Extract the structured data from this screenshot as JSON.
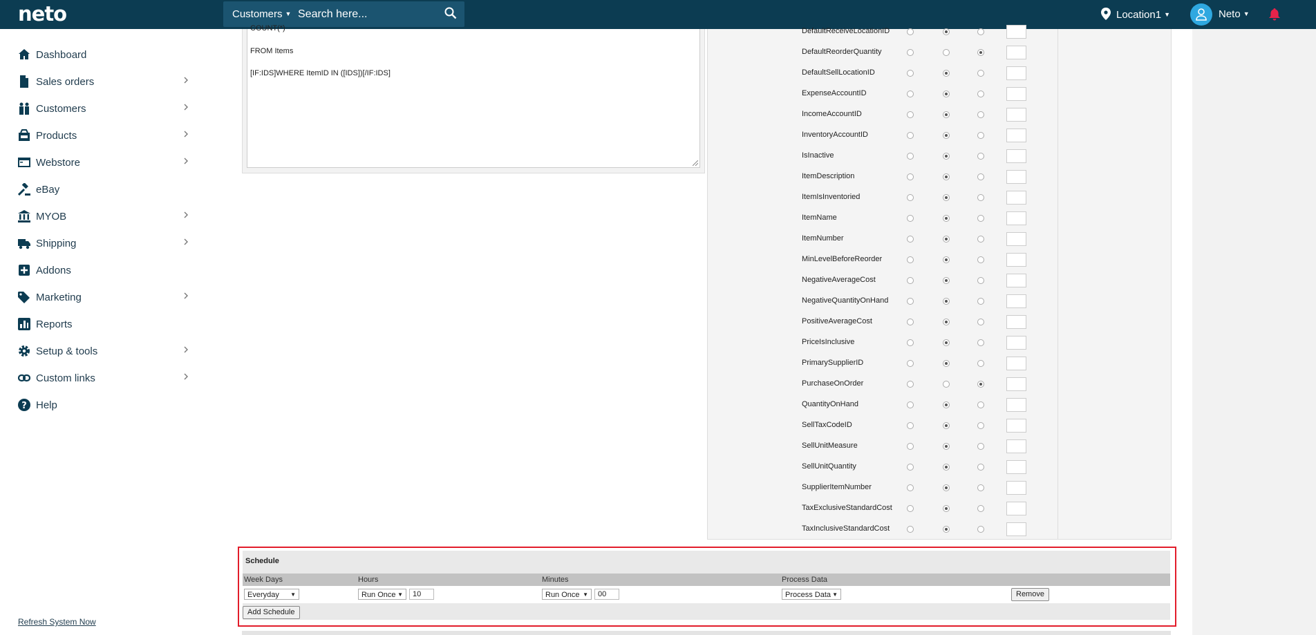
{
  "topbar": {
    "logo": "neto",
    "search_scope": "Customers",
    "search_placeholder": "Search here...",
    "location": "Location1",
    "user": "Neto"
  },
  "sidebar": {
    "items": [
      {
        "label": "Dashboard",
        "icon": "home-icon",
        "has_chevron": false
      },
      {
        "label": "Sales orders",
        "icon": "document-icon",
        "has_chevron": true
      },
      {
        "label": "Customers",
        "icon": "people-icon",
        "has_chevron": true
      },
      {
        "label": "Products",
        "icon": "products-icon",
        "has_chevron": true
      },
      {
        "label": "Webstore",
        "icon": "webstore-icon",
        "has_chevron": true
      },
      {
        "label": "eBay",
        "icon": "gavel-icon",
        "has_chevron": false
      },
      {
        "label": "MYOB",
        "icon": "bank-icon",
        "has_chevron": true
      },
      {
        "label": "Shipping",
        "icon": "truck-icon",
        "has_chevron": true
      },
      {
        "label": "Addons",
        "icon": "plus-square-icon",
        "has_chevron": false
      },
      {
        "label": "Marketing",
        "icon": "tag-icon",
        "has_chevron": true
      },
      {
        "label": "Reports",
        "icon": "chart-icon",
        "has_chevron": false
      },
      {
        "label": "Setup & tools",
        "icon": "gear-icon",
        "has_chevron": true
      },
      {
        "label": "Custom links",
        "icon": "link-icon",
        "has_chevron": true
      },
      {
        "label": "Help",
        "icon": "help-icon",
        "has_chevron": false
      }
    ],
    "refresh_link": "Refresh System Now"
  },
  "sql": {
    "lines": [
      "COUNT(*)",
      "FROM Items",
      "[IF:IDS]WHERE ItemID IN ([IDS])[/IF:IDS]"
    ]
  },
  "fields": {
    "rows": [
      {
        "name": "DefaultReceiveLocationID",
        "selected": 1
      },
      {
        "name": "DefaultReorderQuantity",
        "selected": 2
      },
      {
        "name": "DefaultSellLocationID",
        "selected": 1
      },
      {
        "name": "ExpenseAccountID",
        "selected": 1
      },
      {
        "name": "IncomeAccountID",
        "selected": 1
      },
      {
        "name": "InventoryAccountID",
        "selected": 1
      },
      {
        "name": "IsInactive",
        "selected": 1
      },
      {
        "name": "ItemDescription",
        "selected": 1
      },
      {
        "name": "ItemIsInventoried",
        "selected": 1
      },
      {
        "name": "ItemName",
        "selected": 1
      },
      {
        "name": "ItemNumber",
        "selected": 1
      },
      {
        "name": "MinLevelBeforeReorder",
        "selected": 1
      },
      {
        "name": "NegativeAverageCost",
        "selected": 1
      },
      {
        "name": "NegativeQuantityOnHand",
        "selected": 1
      },
      {
        "name": "PositiveAverageCost",
        "selected": 1
      },
      {
        "name": "PriceIsInclusive",
        "selected": 1
      },
      {
        "name": "PrimarySupplierID",
        "selected": 1
      },
      {
        "name": "PurchaseOnOrder",
        "selected": 2
      },
      {
        "name": "QuantityOnHand",
        "selected": 1
      },
      {
        "name": "SellTaxCodeID",
        "selected": 1
      },
      {
        "name": "SellUnitMeasure",
        "selected": 1
      },
      {
        "name": "SellUnitQuantity",
        "selected": 1
      },
      {
        "name": "SupplierItemNumber",
        "selected": 1
      },
      {
        "name": "TaxExclusiveStandardCost",
        "selected": 1
      },
      {
        "name": "TaxInclusiveStandardCost",
        "selected": 1
      }
    ]
  },
  "schedule": {
    "title": "Schedule",
    "headers": {
      "week_days": "Week Days",
      "hours": "Hours",
      "minutes": "Minutes",
      "process_data": "Process Data"
    },
    "row": {
      "week_days": "Everyday",
      "hours_mode": "Run Once",
      "hours_value": "10",
      "minutes_mode": "Run Once",
      "minutes_value": "00",
      "process_data": "Process Data",
      "remove_label": "Remove"
    },
    "add_label": "Add Schedule"
  },
  "colors": {
    "topbar": "#0c3c52",
    "accent": "#2fa8e0",
    "bell": "#e8234a",
    "highlight_border": "#e21c2a"
  }
}
